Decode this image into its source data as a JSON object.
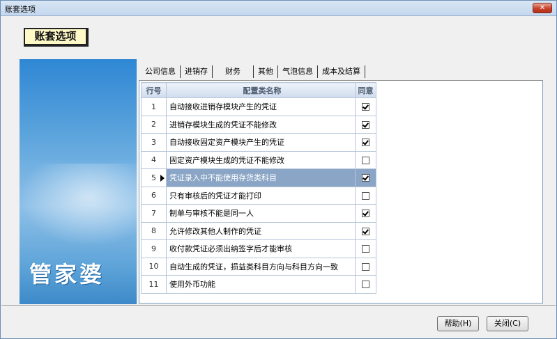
{
  "window": {
    "title": "账套选项",
    "close_glyph": "✕"
  },
  "header": {
    "bookmark_title": "账套选项"
  },
  "brand": {
    "logo_text": "管家婆"
  },
  "tabs": [
    {
      "label": "公司信息"
    },
    {
      "label": "进销存"
    },
    {
      "label": "财务",
      "active": true
    },
    {
      "label": "其他"
    },
    {
      "label": "气泡信息"
    },
    {
      "label": "成本及结算"
    }
  ],
  "grid": {
    "headers": {
      "no": "行号",
      "name": "配置类名称",
      "agree": "同意"
    },
    "selected_row": 5,
    "rows": [
      {
        "no": "1",
        "name": "自动接收进销存模块产生的凭证",
        "checked": true
      },
      {
        "no": "2",
        "name": "进销存模块生成的凭证不能修改",
        "checked": true
      },
      {
        "no": "3",
        "name": "自动接收固定资产模块产生的凭证",
        "checked": true
      },
      {
        "no": "4",
        "name": "固定资产模块生成的凭证不能修改",
        "checked": false
      },
      {
        "no": "5",
        "name": "凭证录入中不能使用存货类科目",
        "checked": true
      },
      {
        "no": "6",
        "name": "只有审核后的凭证才能打印",
        "checked": false
      },
      {
        "no": "7",
        "name": "制单与审核不能是同一人",
        "checked": true
      },
      {
        "no": "8",
        "name": "允许修改其他人制作的凭证",
        "checked": true
      },
      {
        "no": "9",
        "name": "收付款凭证必须出纳签字后才能审核",
        "checked": false
      },
      {
        "no": "10",
        "name": "自动生成的凭证，损益类科目方向与科目方向一致",
        "checked": false
      },
      {
        "no": "11",
        "name": "使用外币功能",
        "checked": false
      }
    ]
  },
  "footer": {
    "help_label": "帮助(H)",
    "close_label": "关闭(C)"
  },
  "colors": {
    "selection": "#8aa5c6",
    "panel_blue": "#2f87d4"
  }
}
